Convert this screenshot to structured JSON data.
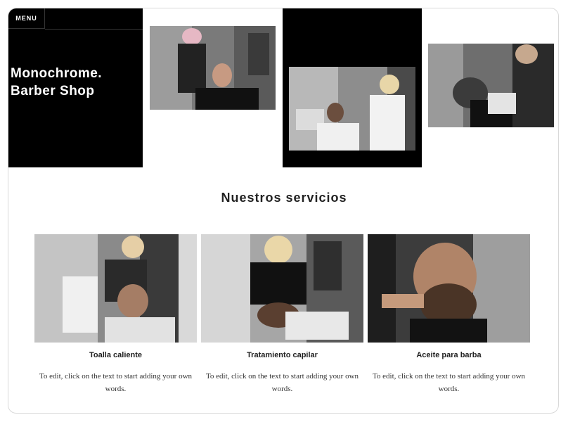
{
  "header": {
    "menu_label": "MENU",
    "title_line1": "Monochrome.",
    "title_line2": "Barber Shop"
  },
  "hero_photos": [
    {
      "icon": "barber-haircut-photo"
    },
    {
      "icon": "barber-trim-photo"
    },
    {
      "icon": "barber-shave-photo"
    }
  ],
  "services": {
    "heading": "Nuestros servicios",
    "items": [
      {
        "title": "Toalla caliente",
        "text": "To edit, click on the text to start adding your own words."
      },
      {
        "title": "Tratamiento capilar",
        "text": "To edit, click on the text to start adding your own words."
      },
      {
        "title": "Aceite para barba",
        "text": "To edit, click on the text to start adding your own words."
      }
    ]
  },
  "colors": {
    "hero_bg": "#000000",
    "text": "#222222",
    "border": "#d9d9d9"
  }
}
